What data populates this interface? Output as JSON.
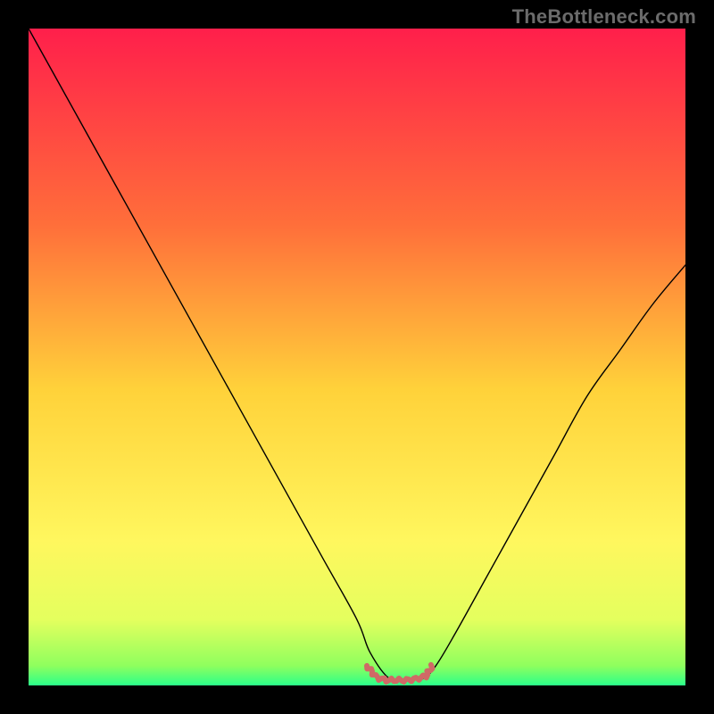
{
  "watermark": {
    "text": "TheBottleneck.com"
  },
  "chart_data": {
    "type": "line",
    "title": "",
    "xlabel": "",
    "ylabel": "",
    "xlim": [
      0,
      100
    ],
    "ylim": [
      0,
      100
    ],
    "grid": false,
    "legend": false,
    "background_gradient": {
      "stops": [
        {
          "offset": 0.0,
          "color": "#ff1f4b"
        },
        {
          "offset": 0.3,
          "color": "#ff6f3a"
        },
        {
          "offset": 0.55,
          "color": "#ffd23a"
        },
        {
          "offset": 0.78,
          "color": "#fff75e"
        },
        {
          "offset": 0.9,
          "color": "#e4ff5e"
        },
        {
          "offset": 0.97,
          "color": "#8fff5e"
        },
        {
          "offset": 1.0,
          "color": "#2bff8a"
        }
      ]
    },
    "series": [
      {
        "name": "bottleneck-curve",
        "color": "#000000",
        "width": 1.4,
        "x": [
          0,
          5,
          10,
          15,
          20,
          25,
          30,
          35,
          40,
          45,
          50,
          52,
          55,
          58,
          60,
          62,
          65,
          70,
          75,
          80,
          85,
          90,
          95,
          100
        ],
        "y": [
          100,
          91,
          82,
          73,
          64,
          55,
          46,
          37,
          28,
          19,
          10,
          5,
          1,
          1,
          1,
          3,
          8,
          17,
          26,
          35,
          44,
          51,
          58,
          64
        ]
      },
      {
        "name": "optimal-region",
        "color": "#cf6a66",
        "width": 6,
        "style": "squiggle",
        "x": [
          51.5,
          53.0,
          54.5,
          56.0,
          57.5,
          59.0,
          60.5,
          61.5
        ],
        "y": [
          3.0,
          1.2,
          0.8,
          0.8,
          0.8,
          1.0,
          1.4,
          3.0
        ]
      }
    ]
  }
}
